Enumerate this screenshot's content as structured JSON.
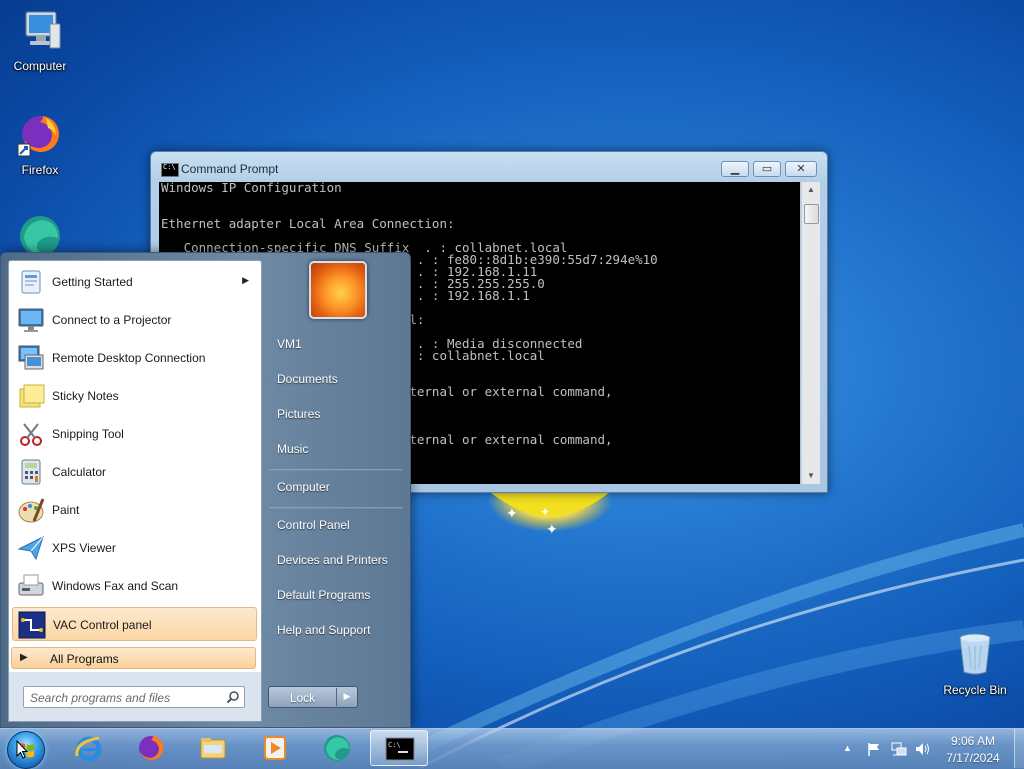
{
  "desktop": {
    "icons": [
      {
        "label": "Computer",
        "icon": "computer-icon"
      },
      {
        "label": "Firefox",
        "icon": "firefox-icon"
      },
      {
        "label": "",
        "icon": "edge-icon"
      },
      {
        "label": "Recycle Bin",
        "icon": "recycle-bin-icon"
      }
    ]
  },
  "cmd": {
    "title": "Command Prompt",
    "lines": [
      "Windows IP Configuration",
      "",
      "",
      "Ethernet adapter Local Area Connection:",
      "",
      "   Connection-specific DNS Suffix  . : collabnet.local",
      "                            . . . . : fe80::8d1b:e390:55d7:294e%10",
      "                            . . . . : 192.168.1.11",
      "                            . . . . : 255.255.255.0",
      "                            . . . . : 192.168.1.1",
      "",
      "                            .local:",
      "",
      "                            . . . . : Media disconnected",
      "                            ix  . : collabnet.local",
      "",
      "",
      "                            an internal or external command,",
      "",
      "",
      "",
      "                            an internal or external command,"
    ]
  },
  "start_menu": {
    "programs": [
      {
        "label": "Getting Started",
        "icon": "getting-started-icon",
        "has_submenu": true
      },
      {
        "label": "Connect to a Projector",
        "icon": "projector-icon"
      },
      {
        "label": "Remote Desktop Connection",
        "icon": "remote-desktop-icon"
      },
      {
        "label": "Sticky Notes",
        "icon": "sticky-notes-icon"
      },
      {
        "label": "Snipping Tool",
        "icon": "snipping-tool-icon"
      },
      {
        "label": "Calculator",
        "icon": "calculator-icon"
      },
      {
        "label": "Paint",
        "icon": "paint-icon"
      },
      {
        "label": "XPS Viewer",
        "icon": "xps-viewer-icon"
      },
      {
        "label": "Windows Fax and Scan",
        "icon": "fax-scan-icon"
      },
      {
        "label": "VAC Control panel",
        "icon": "vac-control-icon",
        "highlighted": true
      }
    ],
    "all_programs": "All Programs",
    "search_placeholder": "Search programs and files",
    "right_items": [
      "VM1",
      "Documents",
      "Pictures",
      "Music",
      "Computer",
      "Control Panel",
      "Devices and Printers",
      "Default Programs",
      "Help and Support"
    ],
    "lock_label": "Lock"
  },
  "taskbar": {
    "apps": [
      "internet-explorer-icon",
      "firefox-icon",
      "file-explorer-icon",
      "media-player-icon",
      "edge-icon",
      "command-prompt-icon"
    ],
    "time": "9:06 AM",
    "date": "7/17/2024"
  },
  "colors": {
    "accent_highlight": "#fbd6a4",
    "wallpaper": "#1460bd"
  }
}
